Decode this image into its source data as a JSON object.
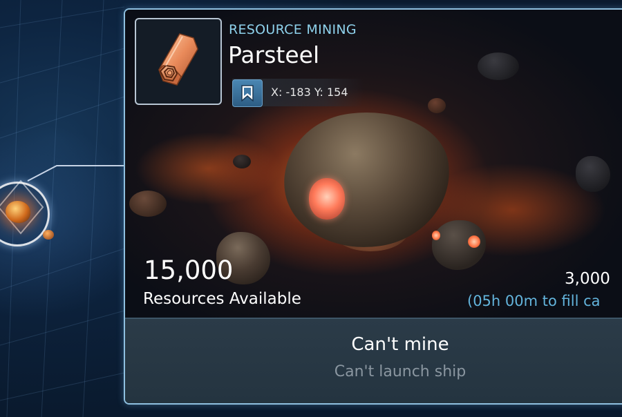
{
  "panel": {
    "category": "RESOURCE MINING",
    "resource_name": "Parsteel",
    "resource_icon": "parsteel-ingot-icon",
    "bookmark_icon": "bookmark-icon",
    "coordinates": "X: -183 Y: 154"
  },
  "stats": {
    "available_value": "15,000",
    "available_label": "Resources Available",
    "cargo_value": "3,000",
    "fill_time": "(05h 00m to fill ca"
  },
  "action": {
    "title": "Can't mine",
    "subtitle": "Can't launch ship"
  },
  "colors": {
    "accent_cyan": "#8fd2ec",
    "fill_time_blue": "#63b4dc",
    "panel_border": "#8fc0e0",
    "bookmark_blue": "#3f78a4",
    "action_bg": "#2b3b48"
  }
}
